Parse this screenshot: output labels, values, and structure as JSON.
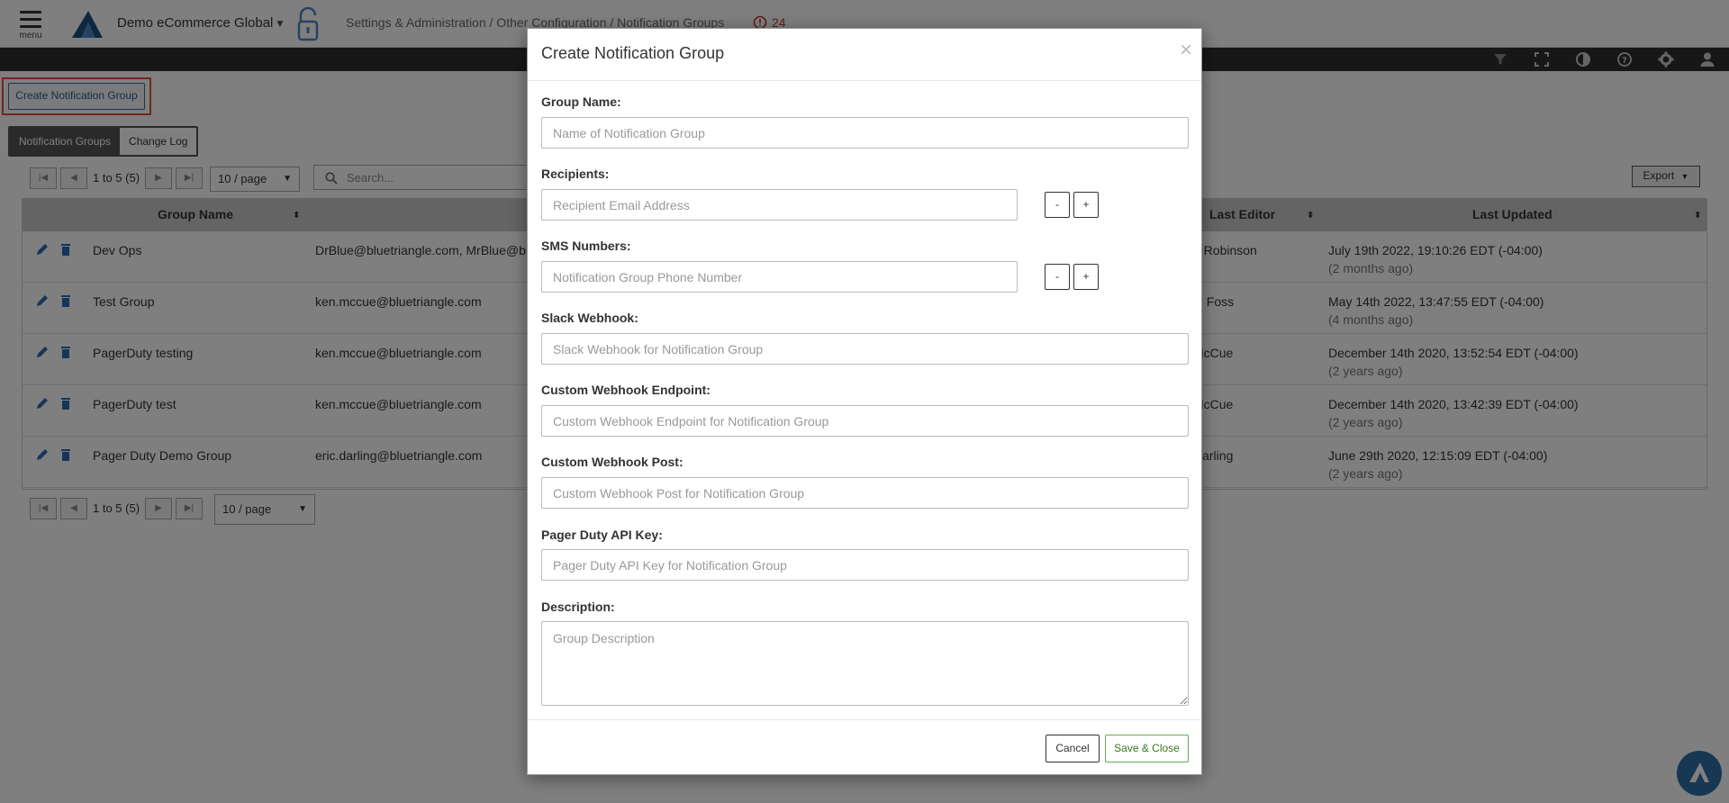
{
  "header": {
    "menu_label": "menu",
    "org_name": "Demo eCommerce Global",
    "breadcrumb": "Settings & Administration / Other Configuration / Notification Groups",
    "alert_count": "24"
  },
  "page": {
    "create_button": "Create Notification Group",
    "tabs": [
      {
        "label": "Notification Groups",
        "active": true
      },
      {
        "label": "Change Log",
        "active": false
      }
    ],
    "pager_text": "1 to 5 (5)",
    "per_page": "10 / page",
    "search_placeholder": "Search...",
    "export_label": "Export"
  },
  "table": {
    "headers": [
      "Group Name",
      "Last Editor",
      "Last Updated"
    ],
    "rows": [
      {
        "name": "Dev Ops",
        "recipients": "DrBlue@bluetriangle.com, MrBlue@blu",
        "editor": "n Robinson",
        "updated": "July 19th 2022, 19:10:26 EDT (-04:00)",
        "ago": "(2 months ago)"
      },
      {
        "name": "Test Group",
        "recipients": "ken.mccue@bluetriangle.com",
        "editor": "el Foss",
        "updated": "May 14th 2022, 13:47:55 EDT (-04:00)",
        "ago": "(4 months ago)"
      },
      {
        "name": "PagerDuty testing",
        "recipients": "ken.mccue@bluetriangle.com",
        "editor": "McCue",
        "updated": "December 14th 2020, 13:52:54 EDT (-04:00)",
        "ago": "(2 years ago)"
      },
      {
        "name": "PagerDuty test",
        "recipients": "ken.mccue@bluetriangle.com",
        "editor": "McCue",
        "updated": "December 14th 2020, 13:42:39 EDT (-04:00)",
        "ago": "(2 years ago)"
      },
      {
        "name": "Pager Duty Demo Group",
        "recipients": "eric.darling@bluetriangle.com",
        "editor": "Darling",
        "updated": "June 29th 2020, 12:15:09 EDT (-04:00)",
        "ago": "(2 years ago)"
      }
    ]
  },
  "modal": {
    "title": "Create Notification Group",
    "close": "×",
    "fields": {
      "group_name": {
        "label": "Group Name:",
        "placeholder": "Name of Notification Group"
      },
      "recipients": {
        "label": "Recipients:",
        "placeholder": "Recipient Email Address"
      },
      "sms": {
        "label": "SMS Numbers:",
        "placeholder": "Notification Group Phone Number"
      },
      "slack": {
        "label": "Slack Webhook:",
        "placeholder": "Slack Webhook for Notification Group"
      },
      "custom_endpoint": {
        "label": "Custom Webhook Endpoint:",
        "placeholder": "Custom Webhook Endpoint for Notification Group"
      },
      "custom_post": {
        "label": "Custom Webhook Post:",
        "placeholder": "Custom Webhook Post for Notification Group"
      },
      "pagerduty": {
        "label": "Pager Duty API Key:",
        "placeholder": "Pager Duty API Key for Notification Group"
      },
      "description": {
        "label": "Description:",
        "placeholder": "Group Description"
      }
    },
    "minus": "-",
    "plus": "+",
    "cancel": "Cancel",
    "save": "Save & Close"
  },
  "colors": {
    "accent": "#2a5b8f",
    "highlight": "#e74c3c",
    "save": "#6aa84f",
    "alert": "#c0392b"
  }
}
